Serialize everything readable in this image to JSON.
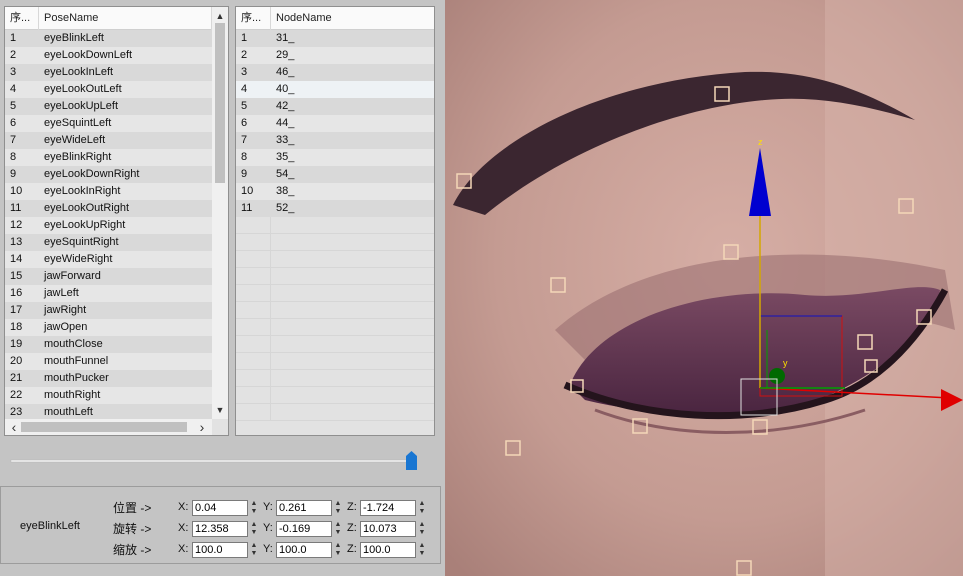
{
  "pose_list": {
    "col_index": "序...",
    "col_name": "PoseName",
    "rows": [
      {
        "n": "1",
        "name": "eyeBlinkLeft"
      },
      {
        "n": "2",
        "name": "eyeLookDownLeft"
      },
      {
        "n": "3",
        "name": "eyeLookInLeft"
      },
      {
        "n": "4",
        "name": "eyeLookOutLeft"
      },
      {
        "n": "5",
        "name": "eyeLookUpLeft"
      },
      {
        "n": "6",
        "name": "eyeSquintLeft"
      },
      {
        "n": "7",
        "name": "eyeWideLeft"
      },
      {
        "n": "8",
        "name": "eyeBlinkRight"
      },
      {
        "n": "9",
        "name": "eyeLookDownRight"
      },
      {
        "n": "10",
        "name": "eyeLookInRight"
      },
      {
        "n": "11",
        "name": "eyeLookOutRight"
      },
      {
        "n": "12",
        "name": "eyeLookUpRight"
      },
      {
        "n": "13",
        "name": "eyeSquintRight"
      },
      {
        "n": "14",
        "name": "eyeWideRight"
      },
      {
        "n": "15",
        "name": "jawForward"
      },
      {
        "n": "16",
        "name": "jawLeft"
      },
      {
        "n": "17",
        "name": "jawRight"
      },
      {
        "n": "18",
        "name": "jawOpen"
      },
      {
        "n": "19",
        "name": "mouthClose"
      },
      {
        "n": "20",
        "name": "mouthFunnel"
      },
      {
        "n": "21",
        "name": "mouthPucker"
      },
      {
        "n": "22",
        "name": "mouthRight"
      },
      {
        "n": "23",
        "name": "mouthLeft"
      }
    ]
  },
  "node_list": {
    "col_index": "序...",
    "col_name": "NodeName",
    "rows": [
      {
        "n": "1",
        "name": "31_"
      },
      {
        "n": "2",
        "name": "29_"
      },
      {
        "n": "3",
        "name": "46_"
      },
      {
        "n": "4",
        "name": "40_"
      },
      {
        "n": "5",
        "name": "42_"
      },
      {
        "n": "6",
        "name": "44_"
      },
      {
        "n": "7",
        "name": "33_"
      },
      {
        "n": "8",
        "name": "35_"
      },
      {
        "n": "9",
        "name": "54_"
      },
      {
        "n": "10",
        "name": "38_"
      },
      {
        "n": "11",
        "name": "52_"
      }
    ],
    "selected_row": "4"
  },
  "slider": {
    "value_fraction": 1.0
  },
  "transform": {
    "pose_label": "eyeBlinkLeft",
    "position_label": "位置 ->",
    "rotation_label": "旋转 ->",
    "scale_label": "缩放 ->",
    "axis_x": "X:",
    "axis_y": "Y:",
    "axis_z": "Z:",
    "position": {
      "x": "0.04",
      "y": "0.261",
      "z": "-1.724"
    },
    "rotation": {
      "x": "12.358",
      "y": "-0.169",
      "z": "10.073"
    },
    "scale": {
      "x": "100.0",
      "y": "100.0",
      "z": "100.0"
    }
  },
  "viewport": {
    "gizmo_label_z": "z",
    "gizmo_label_y": "y",
    "colors": {
      "axis_x": "#e00000",
      "axis_y": "#00a000",
      "axis_z": "#0000d0",
      "handle": "#f4d7b8"
    }
  },
  "icons": {
    "scroll_up": "▲",
    "scroll_down": "▼",
    "scroll_left": "‹",
    "scroll_right": "›",
    "spin_up": "▲",
    "spin_down": "▼"
  }
}
